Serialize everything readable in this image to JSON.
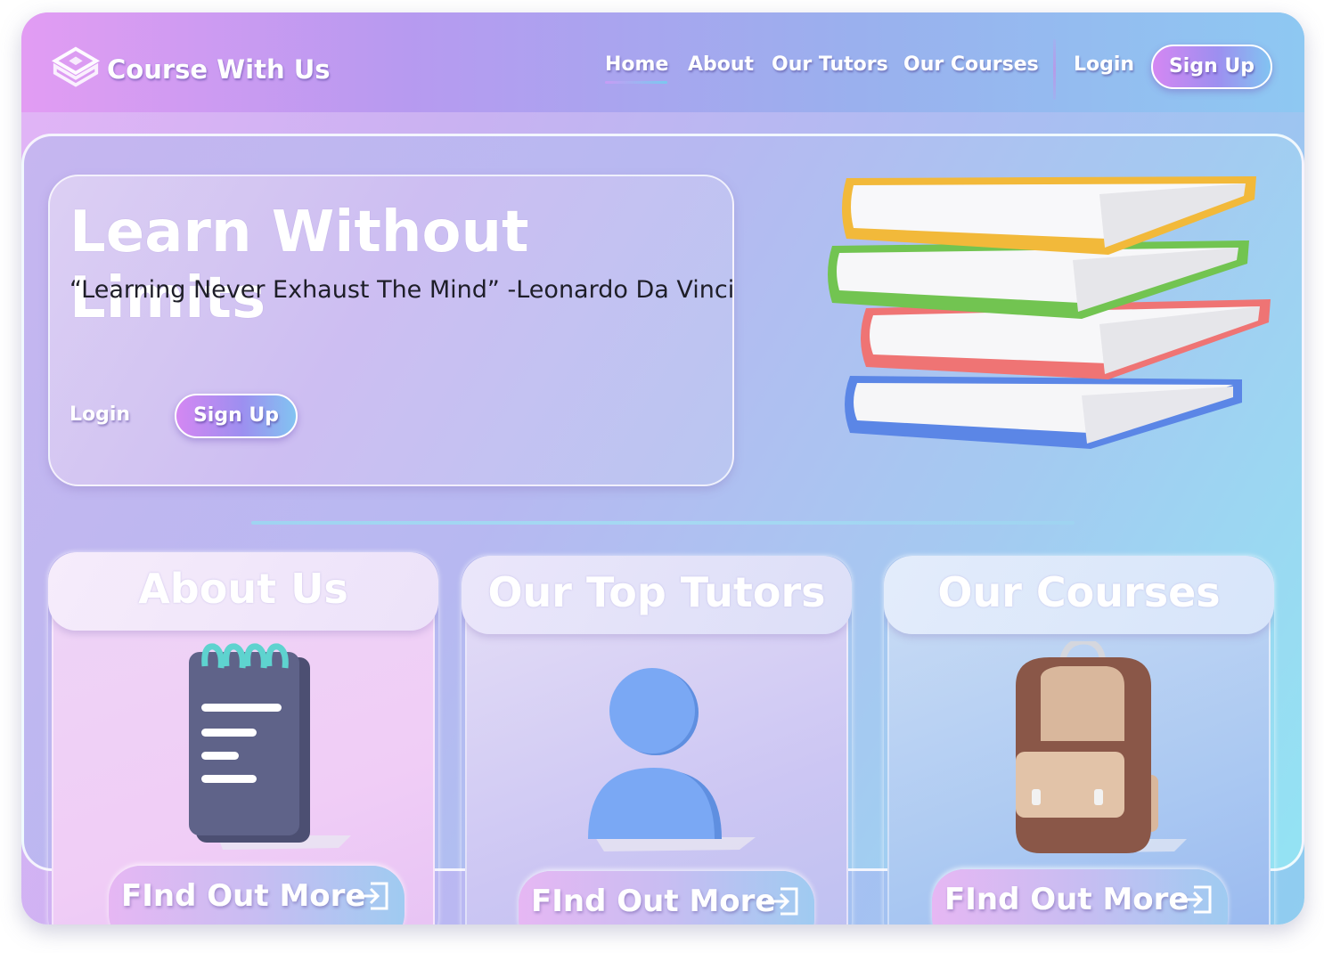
{
  "brand": {
    "name": "Course With Us",
    "logo_icon": "layered-cube-logo-icon"
  },
  "nav": {
    "links": [
      "Home",
      "About",
      "Our Tutors",
      "Our Courses"
    ],
    "active": "Home",
    "login": "Login",
    "signup": "Sign Up"
  },
  "hero": {
    "title": "Learn Without Limits",
    "quote": "“Learning Never Exhaust The Mind” -Leonardo Da Vinci",
    "login": "Login",
    "signup": "Sign Up",
    "illustration": "stacked-books-icon"
  },
  "cards": [
    {
      "title": "About Us",
      "icon": "notepad-icon",
      "cta": "FInd Out More"
    },
    {
      "title": "Our Top Tutors",
      "icon": "user-icon",
      "cta": "FInd Out More"
    },
    {
      "title": "Our Courses",
      "icon": "backpack-icon",
      "cta": "FInd Out More"
    }
  ],
  "colors": {
    "accent_pink": "#d487f2",
    "accent_purple": "#9d8ff0",
    "accent_blue": "#82c3f1",
    "text_dark": "#1e1e28"
  }
}
